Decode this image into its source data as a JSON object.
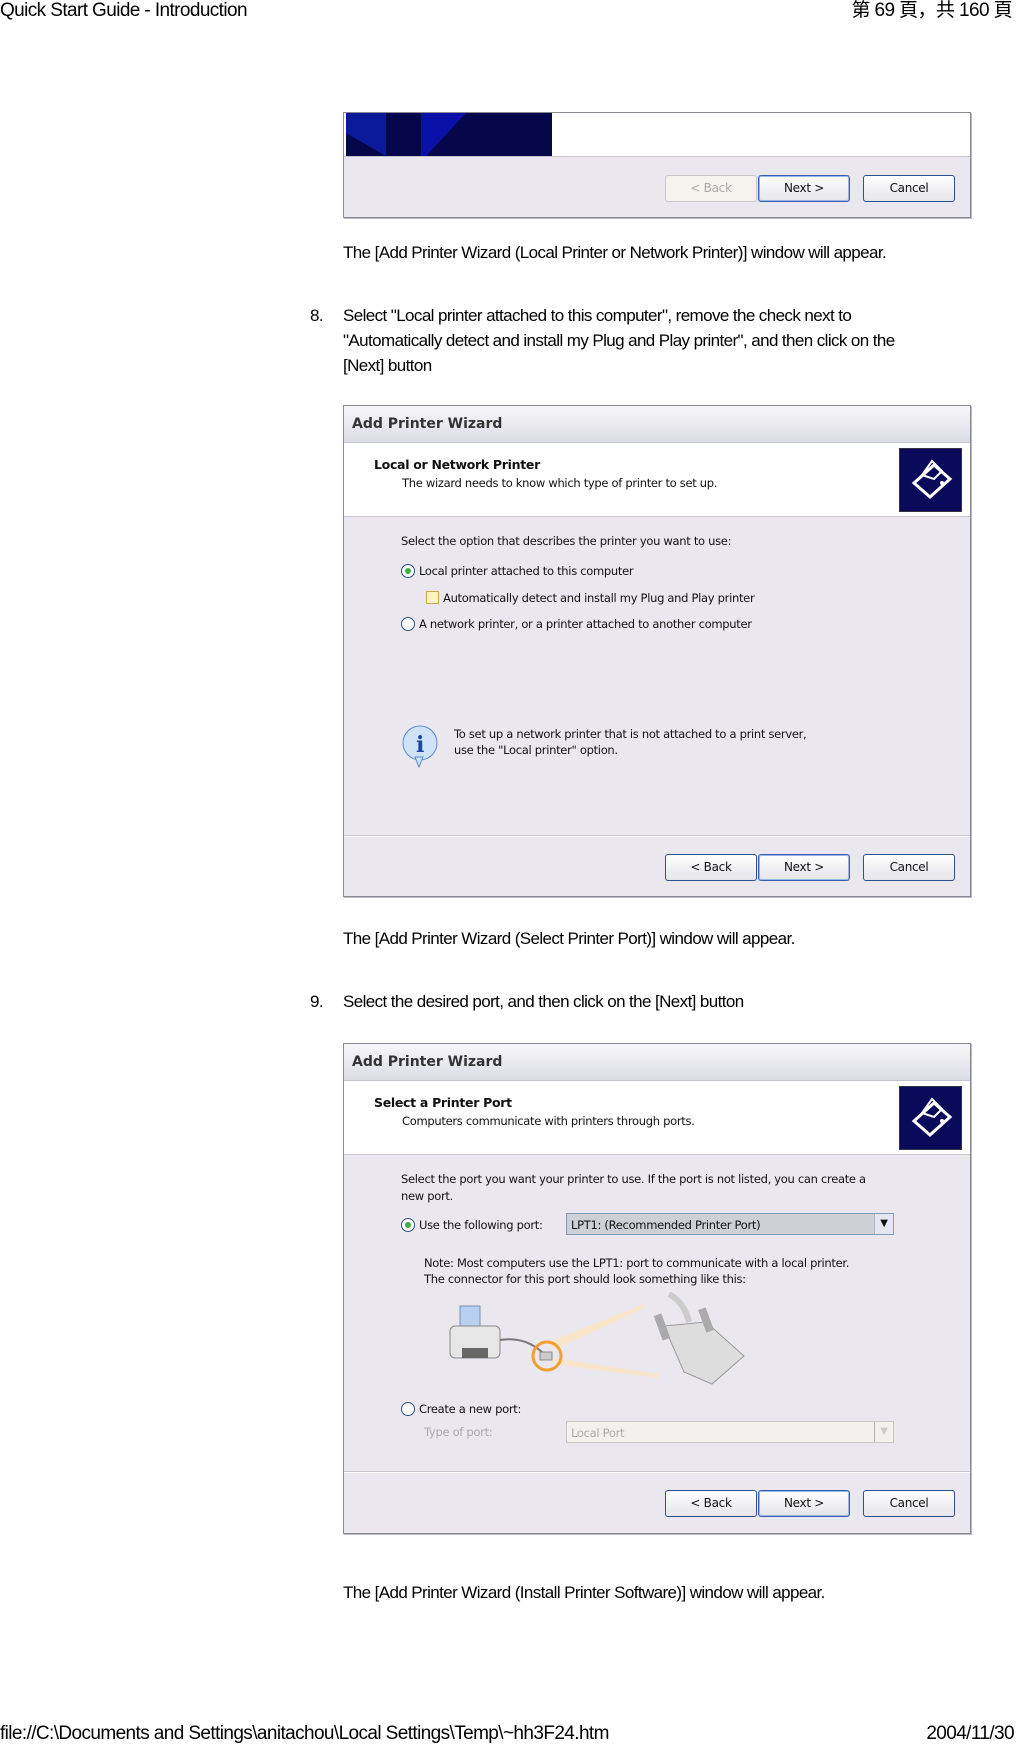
{
  "header": {
    "title": "Quick Start Guide - Introduction",
    "page_indicator": "第 69 頁，共 160 頁"
  },
  "footer": {
    "path": "file://C:\\Documents and Settings\\anitachou\\Local Settings\\Temp\\~hh3F24.htm",
    "date": "2004/11/30"
  },
  "captions": [
    "The [Add Printer Wizard (Local Printer or Network Printer)] window will appear.",
    "The [Add Printer Wizard (Select Printer Port)] window will appear.",
    "The [Add Printer Wizard (Install Printer Software)] window will appear."
  ],
  "steps": [
    {
      "number": "8.",
      "lines": [
        "Select \"Local printer attached to this computer\", remove the check next to",
        "\"Automatically detect and install my Plug and Play printer\", and then click on the",
        "[Next] button"
      ]
    },
    {
      "number": "9.",
      "lines": [
        "Select the desired port, and then click on the [Next] button"
      ]
    }
  ],
  "buttons": {
    "back": "< Back",
    "next": "Next >",
    "cancel": "Cancel"
  },
  "dialog_local": {
    "title": "Add Printer Wizard",
    "heading": "Local or Network Printer",
    "subheading": "The wizard needs to know which type of printer to set up.",
    "prompt": "Select the option that describes the printer you want to use:",
    "option_local": "Local printer attached to this computer",
    "option_local_selected": true,
    "checkbox_auto": "Automatically detect and install my Plug and Play printer",
    "checkbox_auto_checked": false,
    "option_network": "A network printer, or a printer attached to another computer",
    "info_line1": "To set up a network printer that is not attached to a print server,",
    "info_line2": "use the \"Local printer\" option."
  },
  "dialog_port": {
    "title": "Add Printer Wizard",
    "heading": "Select a Printer Port",
    "subheading": "Computers communicate with printers through ports.",
    "prompt_line1": "Select the port you want your printer to use.  If the port is not listed, you can create a",
    "prompt_line2": "new port.",
    "option_use": "Use the following port:",
    "port_value": "LPT1: (Recommended Printer Port)",
    "note_line1": "Note: Most computers use the LPT1: port to communicate with a local printer.",
    "note_line2": "The connector for this port should look something like this:",
    "option_create": "Create a new port:",
    "type_label": "Type of port:",
    "type_value": "Local Port"
  },
  "colors": {
    "dialog_body": "#ebe7ef",
    "banner": "#0a0a5a",
    "radio_dot": "#3cb043",
    "highlight_ring": "#f0a030"
  }
}
